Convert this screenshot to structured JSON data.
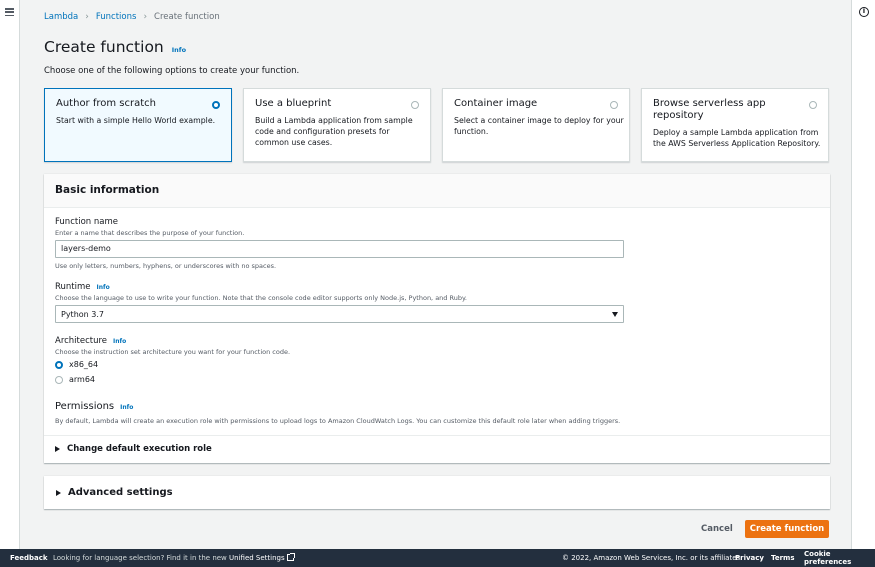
{
  "breadcrumb": {
    "items": [
      "Lambda",
      "Functions",
      "Create function"
    ]
  },
  "page": {
    "title": "Create function",
    "title_info": "Info",
    "description": "Choose one of the following options to create your function."
  },
  "options": [
    {
      "title": "Author from scratch",
      "desc": "Start with a simple Hello World example.",
      "selected": true
    },
    {
      "title": "Use a blueprint",
      "desc": "Build a Lambda application from sample code and configuration presets for common use cases.",
      "selected": false
    },
    {
      "title": "Container image",
      "desc": "Select a container image to deploy for your function.",
      "selected": false
    },
    {
      "title": "Browse serverless app repository",
      "desc": "Deploy a sample Lambda application from the AWS Serverless Application Repository.",
      "selected": false
    }
  ],
  "basic": {
    "header": "Basic information",
    "function_name": {
      "label": "Function name",
      "desc": "Enter a name that describes the purpose of your function.",
      "value": "layers-demo",
      "hint": "Use only letters, numbers, hyphens, or underscores with no spaces."
    },
    "runtime": {
      "label": "Runtime",
      "info": "Info",
      "desc": "Choose the language to use to write your function. Note that the console code editor supports only Node.js, Python, and Ruby.",
      "value": "Python 3.7"
    },
    "architecture": {
      "label": "Architecture",
      "info": "Info",
      "desc": "Choose the instruction set architecture you want for your function code.",
      "options": [
        "x86_64",
        "arm64"
      ],
      "selected": "x86_64"
    },
    "permissions": {
      "label": "Permissions",
      "info": "Info",
      "desc": "By default, Lambda will create an execution role with permissions to upload logs to Amazon CloudWatch Logs. You can customize this default role later when adding triggers.",
      "expander": "Change default execution role"
    }
  },
  "advanced": {
    "label": "Advanced settings"
  },
  "actions": {
    "cancel": "Cancel",
    "create": "Create function"
  },
  "footer": {
    "feedback": "Feedback",
    "lang_text": "Looking for language selection? Find it in the new",
    "lang_link": "Unified Settings",
    "copyright": "© 2022, Amazon Web Services, Inc. or its affiliates.",
    "privacy": "Privacy",
    "terms": "Terms",
    "cookie": "Cookie preferences"
  },
  "colors": {
    "accent": "#0073bb",
    "primary_button": "#ec7211",
    "footer_bg": "#232f3e"
  }
}
